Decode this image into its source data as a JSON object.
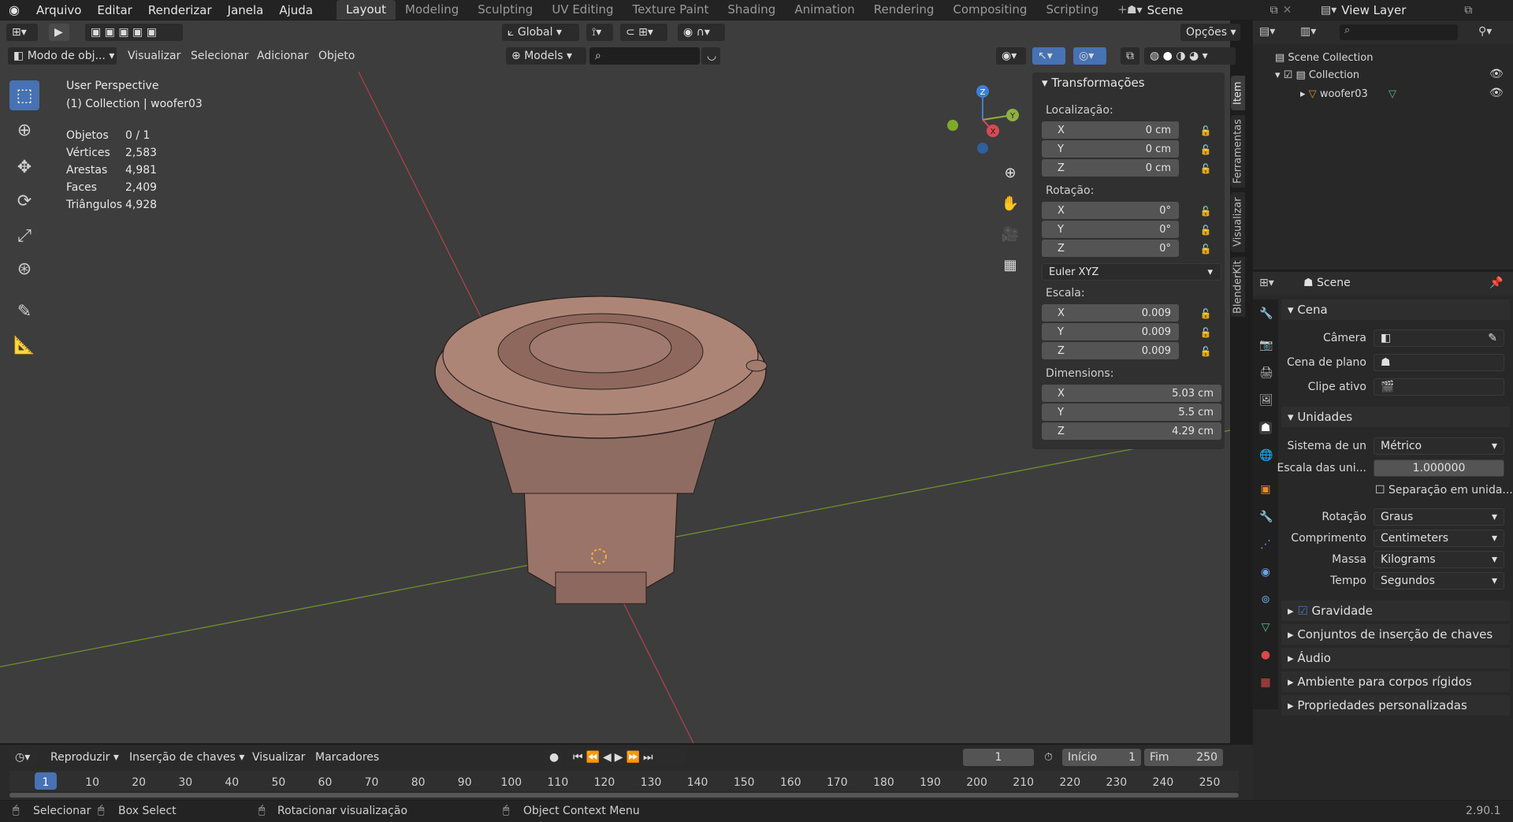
{
  "menu": {
    "items": [
      "Arquivo",
      "Editar",
      "Renderizar",
      "Janela",
      "Ajuda"
    ]
  },
  "workspaces": [
    "Layout",
    "Modeling",
    "Sculpting",
    "UV Editing",
    "Texture Paint",
    "Shading",
    "Animation",
    "Rendering",
    "Compositing",
    "Scripting"
  ],
  "top_right": {
    "scene": "Scene",
    "view_layer": "View Layer"
  },
  "viewport_header": {
    "mode": "Modo de obj...",
    "menus": [
      "Visualizar",
      "Selecionar",
      "Adicionar",
      "Objeto"
    ],
    "transform": "Global",
    "collection": "Models",
    "options": "Opções"
  },
  "overlay": {
    "perspective": "User Perspective",
    "collection_line": "(1) Collection | woofer03",
    "stats": [
      {
        "label": "Objetos",
        "value": "0 / 1"
      },
      {
        "label": "Vértices",
        "value": "2,583"
      },
      {
        "label": "Arestas",
        "value": "4,981"
      },
      {
        "label": "Faces",
        "value": "2,409"
      },
      {
        "label": "Triângulos",
        "value": "4,928"
      }
    ]
  },
  "gizmo": {
    "x": "X",
    "y": "Y",
    "z": "Z"
  },
  "npanel": {
    "title": "Transformações",
    "location_label": "Localização:",
    "location": [
      {
        "axis": "X",
        "value": "0 cm"
      },
      {
        "axis": "Y",
        "value": "0 cm"
      },
      {
        "axis": "Z",
        "value": "0 cm"
      }
    ],
    "rotation_label": "Rotação:",
    "rotation": [
      {
        "axis": "X",
        "value": "0°"
      },
      {
        "axis": "Y",
        "value": "0°"
      },
      {
        "axis": "Z",
        "value": "0°"
      }
    ],
    "rotation_mode": "Euler XYZ",
    "scale_label": "Escala:",
    "scale": [
      {
        "axis": "X",
        "value": "0.009"
      },
      {
        "axis": "Y",
        "value": "0.009"
      },
      {
        "axis": "Z",
        "value": "0.009"
      }
    ],
    "dimensions_label": "Dimensions:",
    "dimensions": [
      {
        "axis": "X",
        "value": "5.03 cm"
      },
      {
        "axis": "Y",
        "value": "5.5 cm"
      },
      {
        "axis": "Z",
        "value": "4.29 cm"
      }
    ],
    "tabs": [
      "Item",
      "Ferramentas",
      "Visualizar",
      "BlenderKit"
    ]
  },
  "outliner": {
    "scene_collection": "Scene Collection",
    "collection": "Collection",
    "object": "woofer03"
  },
  "properties": {
    "context": "Scene",
    "cena": "Cena",
    "camera_label": "Câmera",
    "bg_scene_label": "Cena de plano",
    "clip_label": "Clipe ativo",
    "unidades": "Unidades",
    "unit_system_label": "Sistema de un",
    "unit_system": "Métrico",
    "unit_scale_label": "Escala das uni...",
    "unit_scale": "1.000000",
    "separate_units": "Separação em unida...",
    "rotation_label": "Rotação",
    "rotation": "Graus",
    "length_label": "Comprimento",
    "length": "Centimeters",
    "mass_label": "Massa",
    "mass": "Kilograms",
    "time_label": "Tempo",
    "time": "Segundos",
    "gravity": "Gravidade",
    "keying_sets": "Conjuntos de inserção de chaves",
    "audio": "Áudio",
    "rigid_body": "Ambiente para corpos rígidos",
    "custom_props": "Propriedades personalizadas"
  },
  "timeline": {
    "menus": [
      "Reproduzir",
      "Inserção de chaves",
      "Visualizar",
      "Marcadores"
    ],
    "current_frame": "1",
    "start_label": "Início",
    "start": "1",
    "end_label": "Fim",
    "end": "250",
    "frames": [
      "1",
      "10",
      "20",
      "30",
      "40",
      "50",
      "60",
      "70",
      "80",
      "90",
      "100",
      "110",
      "120",
      "130",
      "140",
      "150",
      "160",
      "170",
      "180",
      "190",
      "200",
      "210",
      "220",
      "230",
      "240",
      "250"
    ]
  },
  "statusbar": {
    "select": "Selecionar",
    "box_select": "Box Select",
    "rotate": "Rotacionar visualização",
    "context_menu": "Object Context Menu",
    "version": "2.90.1"
  },
  "colors": {
    "accent": "#4772b3",
    "x_axis": "#d44a50",
    "y_axis": "#7ea23a",
    "mesh": "#9a7468"
  }
}
